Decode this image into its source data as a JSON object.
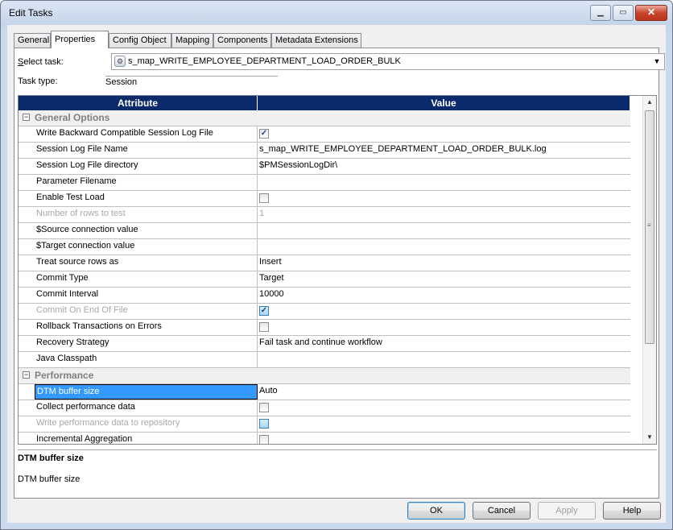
{
  "window": {
    "title": "Edit Tasks"
  },
  "tabs": [
    "General",
    "Properties",
    "Config Object",
    "Mapping",
    "Components",
    "Metadata Extensions"
  ],
  "select_task": {
    "label_prefix": "S",
    "label_rest": "elect task:",
    "value": "s_map_WRITE_EMPLOYEE_DEPARTMENT_LOAD_ORDER_BULK"
  },
  "task_type": {
    "label": "Task type:",
    "value": "Session"
  },
  "grid": {
    "headers": {
      "attribute": "Attribute",
      "value": "Value"
    },
    "categories": {
      "general": "General Options",
      "performance": "Performance"
    },
    "rows": [
      {
        "attr": "Write Backward Compatible Session Log File",
        "value": "",
        "check": true
      },
      {
        "attr": "Session Log File Name",
        "value": "s_map_WRITE_EMPLOYEE_DEPARTMENT_LOAD_ORDER_BULK.log"
      },
      {
        "attr": "Session Log File directory",
        "value": "$PMSessionLogDir\\"
      },
      {
        "attr": "Parameter Filename",
        "value": ""
      },
      {
        "attr": "Enable Test Load",
        "value": "",
        "check": false
      },
      {
        "attr": "Number of rows to test",
        "value": "1",
        "disabled": true
      },
      {
        "attr": "$Source connection value",
        "value": ""
      },
      {
        "attr": "$Target connection value",
        "value": ""
      },
      {
        "attr": "Treat source rows as",
        "value": "Insert"
      },
      {
        "attr": "Commit Type",
        "value": "Target"
      },
      {
        "attr": "Commit Interval",
        "value": "10000"
      },
      {
        "attr": "Commit On End Of File",
        "value": "",
        "check": true,
        "disabled": true
      },
      {
        "attr": "Rollback Transactions on Errors",
        "value": "",
        "check": false
      },
      {
        "attr": "Recovery Strategy",
        "value": "Fail task and continue workflow"
      },
      {
        "attr": "Java Classpath",
        "value": ""
      },
      {
        "attr": "DTM buffer size",
        "value": "Auto",
        "selected": true
      },
      {
        "attr": "Collect performance data",
        "value": "",
        "check": false
      },
      {
        "attr": "Write performance data to repository",
        "value": "",
        "check": false,
        "disabled": true
      },
      {
        "attr": "Incremental Aggregation",
        "value": "",
        "check": false
      }
    ]
  },
  "description": {
    "title": "DTM buffer size",
    "text": "DTM buffer size"
  },
  "buttons": {
    "ok": "OK",
    "cancel": "Cancel",
    "apply": "Apply",
    "help": "Help"
  },
  "icons": {
    "minimize": "minimize-icon",
    "maximize": "maximize-icon",
    "close": "close-icon",
    "session": "session-task-icon",
    "dropdown": "chevron-down-icon"
  }
}
